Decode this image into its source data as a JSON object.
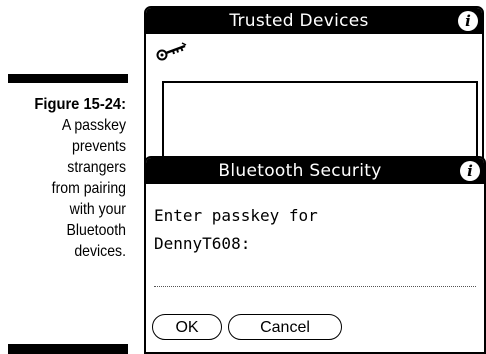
{
  "caption": {
    "figure": "Figure 15-24:",
    "lines": [
      "A passkey",
      "prevents",
      "strangers",
      "from pairing",
      "with your",
      "Bluetooth",
      "devices."
    ]
  },
  "trusted_window": {
    "title": "Trusted Devices",
    "info_glyph": "i",
    "icons": [
      "key-icon",
      "info-icon"
    ]
  },
  "security_dialog": {
    "title": "Bluetooth Security",
    "info_glyph": "i",
    "prompt_line1": "Enter passkey for",
    "prompt_line2": "DennyT608:",
    "passkey_value": "",
    "ok_label": "OK",
    "cancel_label": "Cancel"
  },
  "colors": {
    "titlebar": "#000000",
    "background": "#ffffff"
  }
}
